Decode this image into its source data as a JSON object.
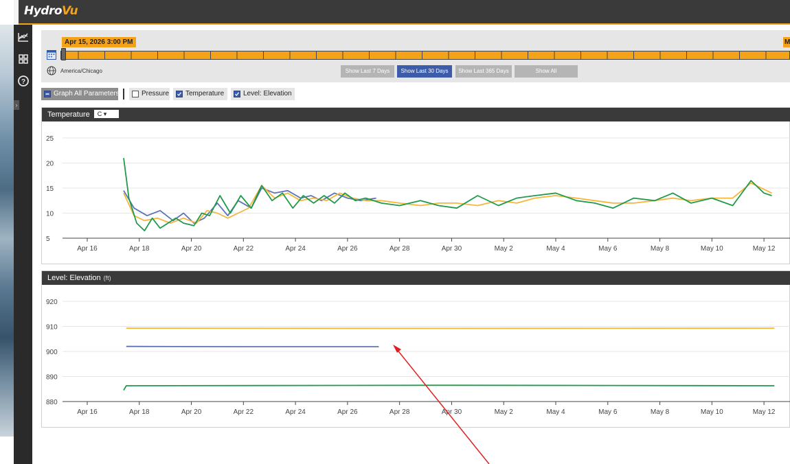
{
  "app": {
    "logo_main": "Hydro",
    "logo_accent": "Vu"
  },
  "nav": {
    "icons": [
      "chart-icon",
      "grid-icon",
      "help-icon"
    ]
  },
  "timeline": {
    "selected_time": "Apr 15, 2026 3:00 PM",
    "right_marker": "M",
    "timezone": "America/Chicago",
    "buttons": [
      {
        "label": "Show Last 7 Days",
        "active": false
      },
      {
        "label": "Show Last 30 Days",
        "active": true
      },
      {
        "label": "Show Last 365 Days",
        "active": false
      },
      {
        "label": "Show All",
        "active": false
      }
    ]
  },
  "parameters": {
    "graph_all": "Graph All Parameters",
    "items": [
      {
        "label": "Pressure",
        "checked": false
      },
      {
        "label": "Temperature",
        "checked": true
      },
      {
        "label": "Level: Elevation",
        "checked": true
      }
    ]
  },
  "colors": {
    "accent": "#f5a21b",
    "blue_series": "#5b73b8",
    "orange_series": "#f5b63a",
    "green_series": "#1f9a4a"
  },
  "temperature_panel": {
    "title": "Temperature",
    "unit": "C",
    "chart_data": {
      "type": "line",
      "ylim": [
        5,
        25
      ],
      "yticks": [
        "5",
        "10",
        "15",
        "20",
        "25"
      ],
      "xticks": [
        "Apr 16",
        "Apr 18",
        "Apr 20",
        "Apr 22",
        "Apr 24",
        "Apr 26",
        "Apr 28",
        "Apr 30",
        "May 2",
        "May 4",
        "May 6",
        "May 8",
        "May 10",
        "May 12"
      ],
      "series": [
        {
          "color": "blue",
          "x": [
            17.4,
            17.8,
            18.3,
            18.8,
            19.3,
            19.7,
            20.1,
            20.5,
            21.0,
            21.4,
            21.8,
            22.3,
            22.7,
            23.2,
            23.7,
            24.2,
            24.6,
            25.0,
            25.5,
            26.0,
            26.5,
            27.1
          ],
          "y": [
            14.5,
            11,
            9.5,
            10.5,
            8.5,
            10,
            8,
            9,
            12,
            9.5,
            12.5,
            11,
            15,
            14,
            14.5,
            13,
            13.5,
            12.5,
            14,
            13,
            12.5,
            13
          ]
        },
        {
          "color": "orange",
          "x": [
            17.4,
            17.8,
            18.2,
            18.7,
            19.2,
            19.7,
            20.2,
            20.6,
            21.0,
            21.4,
            21.8,
            22.2,
            22.7,
            23.2,
            23.7,
            24.2,
            24.7,
            25.2,
            25.7,
            26.2,
            26.7,
            27.3,
            28.0,
            28.8,
            29.5,
            30.2,
            31.0,
            31.8,
            32.5,
            33.2,
            34.0,
            34.8,
            35.5,
            36.2,
            37.0,
            37.8,
            38.5,
            39.2,
            40.0,
            40.8,
            41.5,
            42.3
          ],
          "y": [
            14,
            9.5,
            8.5,
            9,
            8,
            9,
            8,
            10.5,
            10,
            9,
            10,
            11,
            15.5,
            13,
            14,
            12.5,
            13,
            12.5,
            14,
            13,
            12.5,
            12.5,
            12,
            11.5,
            12,
            12,
            11.5,
            12.5,
            12,
            13,
            13.5,
            13,
            12.5,
            12,
            12,
            12.5,
            13,
            12.5,
            13,
            13,
            16,
            14
          ]
        },
        {
          "color": "green",
          "x": [
            17.4,
            17.6,
            17.9,
            18.2,
            18.5,
            18.8,
            19.1,
            19.4,
            19.7,
            20.1,
            20.4,
            20.7,
            21.1,
            21.5,
            21.9,
            22.3,
            22.7,
            23.1,
            23.5,
            23.9,
            24.3,
            24.7,
            25.1,
            25.5,
            25.9,
            26.3,
            26.7,
            27.3,
            28.0,
            28.8,
            29.5,
            30.2,
            31.0,
            31.8,
            32.5,
            33.2,
            34.0,
            34.8,
            35.5,
            36.2,
            37.0,
            37.8,
            38.5,
            39.2,
            40.0,
            40.8,
            41.5,
            42.0,
            42.3
          ],
          "y": [
            21,
            13,
            8,
            6.5,
            9,
            7,
            8,
            9,
            8,
            7.5,
            10,
            9.5,
            13.5,
            10,
            13.5,
            11,
            15.5,
            12.5,
            14,
            11,
            13.5,
            12,
            13.5,
            12,
            14,
            12.5,
            13,
            12,
            11.5,
            12.5,
            11.5,
            11,
            13.5,
            11.5,
            13,
            13.5,
            14,
            12.5,
            12,
            11,
            13,
            12.5,
            14,
            12,
            13,
            11.5,
            16.5,
            14,
            13.5
          ]
        }
      ]
    }
  },
  "level_panel": {
    "title": "Level: Elevation",
    "unit": "(ft)",
    "chart_data": {
      "type": "line",
      "ylim": [
        880,
        920
      ],
      "yticks": [
        "880",
        "890",
        "900",
        "910",
        "920"
      ],
      "xticks": [
        "Apr 16",
        "Apr 18",
        "Apr 20",
        "Apr 22",
        "Apr 24",
        "Apr 26",
        "Apr 28",
        "Apr 30",
        "May 2",
        "May 4",
        "May 6",
        "May 8",
        "May 10",
        "May 12"
      ],
      "series": [
        {
          "color": "orange",
          "x": [
            17.5,
            30,
            42.4
          ],
          "y": [
            909.3,
            909.2,
            909.3
          ]
        },
        {
          "color": "blue",
          "x": [
            17.5,
            22,
            27.2
          ],
          "y": [
            902,
            901.9,
            901.9
          ]
        },
        {
          "color": "green",
          "x": [
            17.4,
            17.5,
            30,
            42.4
          ],
          "y": [
            884.5,
            886.3,
            886.5,
            886.3
          ]
        }
      ]
    }
  }
}
